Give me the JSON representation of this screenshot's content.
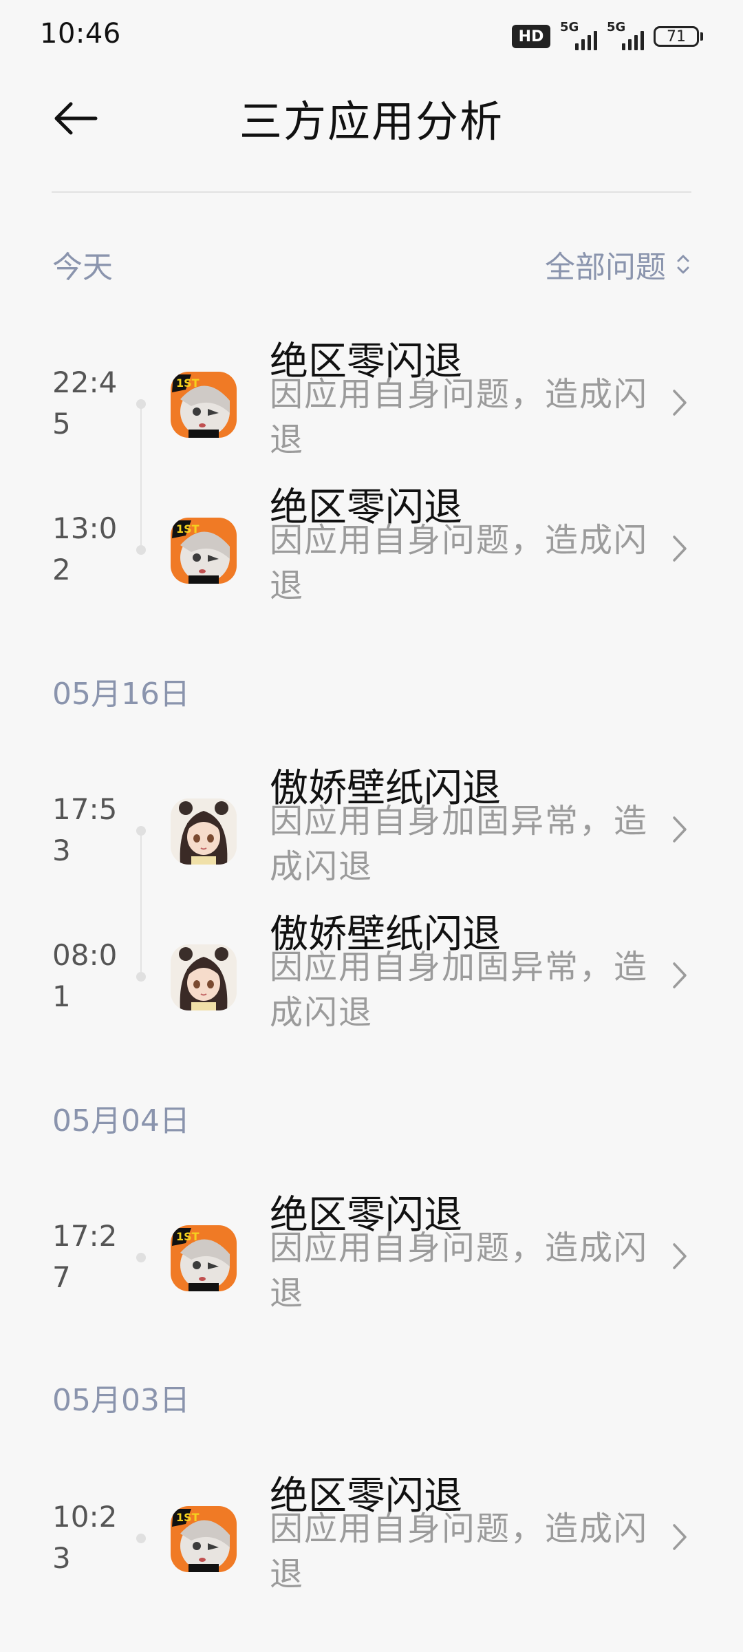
{
  "status_bar": {
    "time": "10:46",
    "hd_label": "HD",
    "sim1_label": "5G",
    "sim2_label": "5G",
    "battery": "71"
  },
  "header": {
    "title": "三方应用分析"
  },
  "filter": {
    "label": "全部问题"
  },
  "sections": [
    {
      "title": "今天",
      "items": [
        {
          "time": "22:45",
          "app": "绝区零闪退",
          "desc": "因应用自身问题，造成闪退",
          "icon": "zzz-app-icon"
        },
        {
          "time": "13:02",
          "app": "绝区零闪退",
          "desc": "因应用自身问题，造成闪退",
          "icon": "zzz-app-icon"
        }
      ]
    },
    {
      "title": "05月16日",
      "items": [
        {
          "time": "17:53",
          "app": "傲娇壁纸闪退",
          "desc": "因应用自身加固异常，造成闪退",
          "icon": "wallpaper-app-icon"
        },
        {
          "time": "08:01",
          "app": "傲娇壁纸闪退",
          "desc": "因应用自身加固异常，造成闪退",
          "icon": "wallpaper-app-icon"
        }
      ]
    },
    {
      "title": "05月04日",
      "items": [
        {
          "time": "17:27",
          "app": "绝区零闪退",
          "desc": "因应用自身问题，造成闪退",
          "icon": "zzz-app-icon"
        }
      ]
    },
    {
      "title": "05月03日",
      "items": [
        {
          "time": "10:23",
          "app": "绝区零闪退",
          "desc": "因应用自身问题，造成闪退",
          "icon": "zzz-app-icon"
        }
      ]
    }
  ],
  "colors": {
    "background": "#f7f7f7",
    "section_title": "#8a94ad",
    "description": "#9b9b9b"
  }
}
